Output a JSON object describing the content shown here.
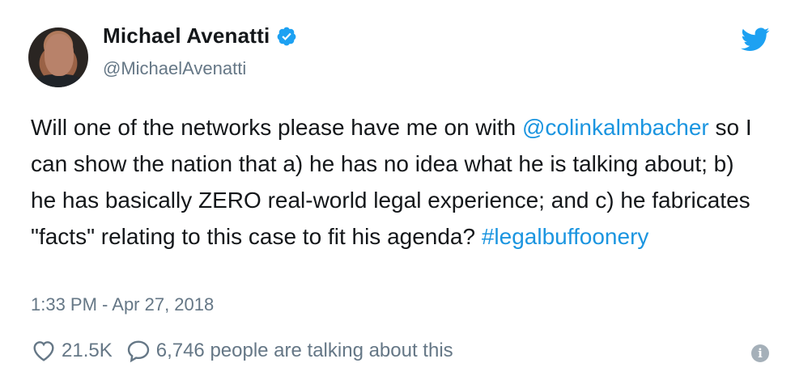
{
  "author": {
    "name": "Michael Avenatti",
    "handle": "@MichaelAvenatti",
    "verified": true,
    "avatar_icon": "profile-photo"
  },
  "tweet": {
    "text_part1": "Will one of the networks please have me on with ",
    "mention": "@colinkalmbacher",
    "text_part2": " so I can show the nation that a) he has no idea what he is talking about; b) he has basically ZERO real-world legal experience; and c) he fabricates \"facts\" relating to this case to fit his agenda? ",
    "hashtag": "#legalbuffoonery"
  },
  "timestamp": "1:33 PM - Apr 27, 2018",
  "actions": {
    "likes": "21.5K",
    "talking": "6,746 people are talking about this"
  },
  "colors": {
    "link": "#1b95e0",
    "muted": "#657786",
    "twitter_blue": "#1da1f2"
  },
  "icons": {
    "brand": "twitter-bird-icon",
    "like": "heart-icon",
    "reply": "speech-bubble-icon",
    "info": "info-icon",
    "verified": "verified-badge-icon"
  }
}
